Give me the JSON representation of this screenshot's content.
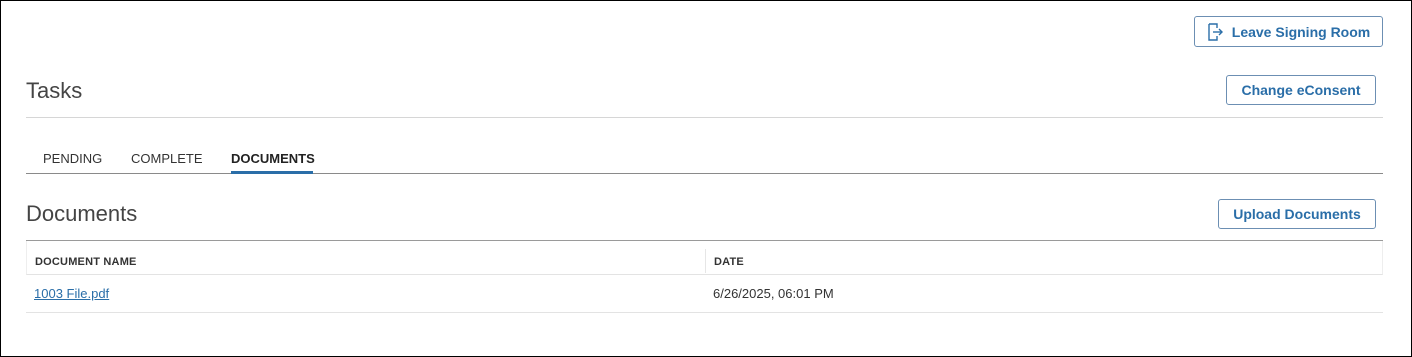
{
  "header": {
    "leave_label": "Leave Signing Room",
    "leave_icon": "exit-door-icon",
    "econsent_label": "Change eConsent"
  },
  "tasks": {
    "title": "Tasks",
    "tabs": [
      {
        "label": "PENDING",
        "active": false
      },
      {
        "label": "COMPLETE",
        "active": false
      },
      {
        "label": "DOCUMENTS",
        "active": true
      }
    ]
  },
  "documents": {
    "title": "Documents",
    "upload_label": "Upload Documents",
    "columns": [
      "DOCUMENT NAME",
      "DATE"
    ],
    "rows": [
      {
        "name": "1003 File.pdf",
        "date": "6/26/2025, 06:01 PM"
      }
    ]
  },
  "colors": {
    "accent": "#2a6ea8",
    "button_border": "#6c8fb3"
  }
}
